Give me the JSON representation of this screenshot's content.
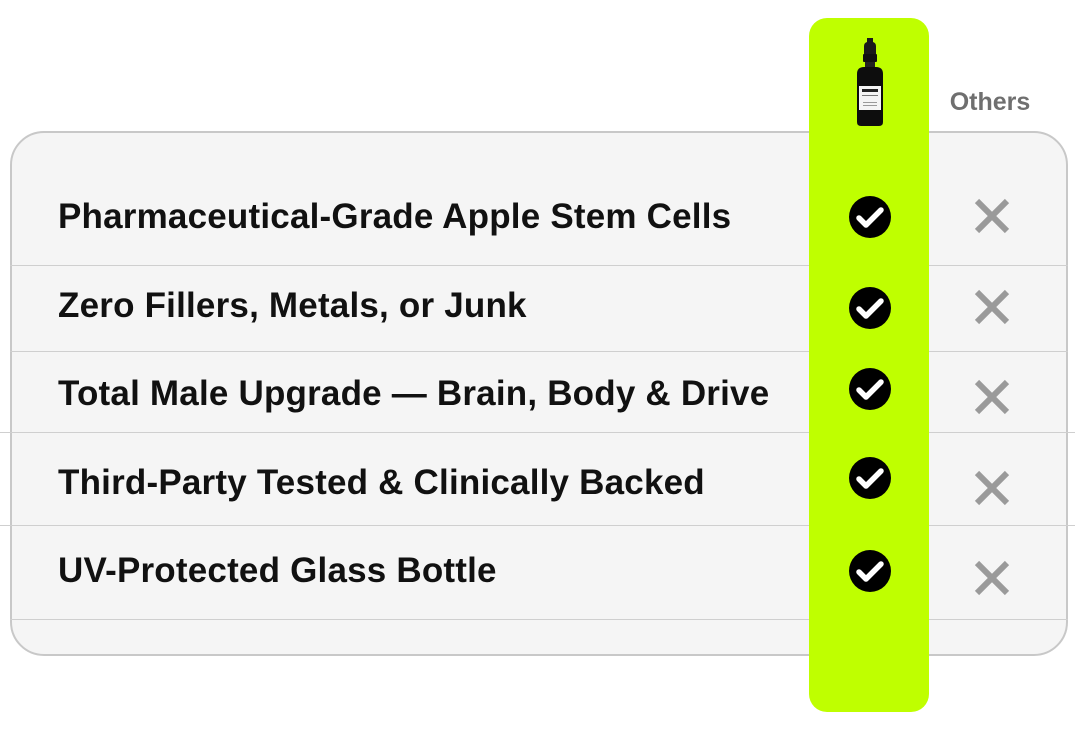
{
  "columns": {
    "brand_product": "dropper-bottle",
    "others_label": "Others"
  },
  "rows": [
    {
      "label": "Pharmaceutical-Grade Apple Stem Cells",
      "brand": true,
      "others": false
    },
    {
      "label": "Zero Fillers, Metals, or Junk",
      "brand": true,
      "others": false
    },
    {
      "label": "Total Male Upgrade — Brain, Body & Drive",
      "brand": true,
      "others": false
    },
    {
      "label": "Third-Party Tested & Clinically Backed",
      "brand": true,
      "others": false
    },
    {
      "label": "UV-Protected Glass Bottle",
      "brand": true,
      "others": false
    }
  ],
  "colors": {
    "highlight": "#bfff00",
    "check": "#000000",
    "cross": "#9a9a9a",
    "card_background": "#f5f5f5",
    "card_border": "#c8c8c8"
  }
}
